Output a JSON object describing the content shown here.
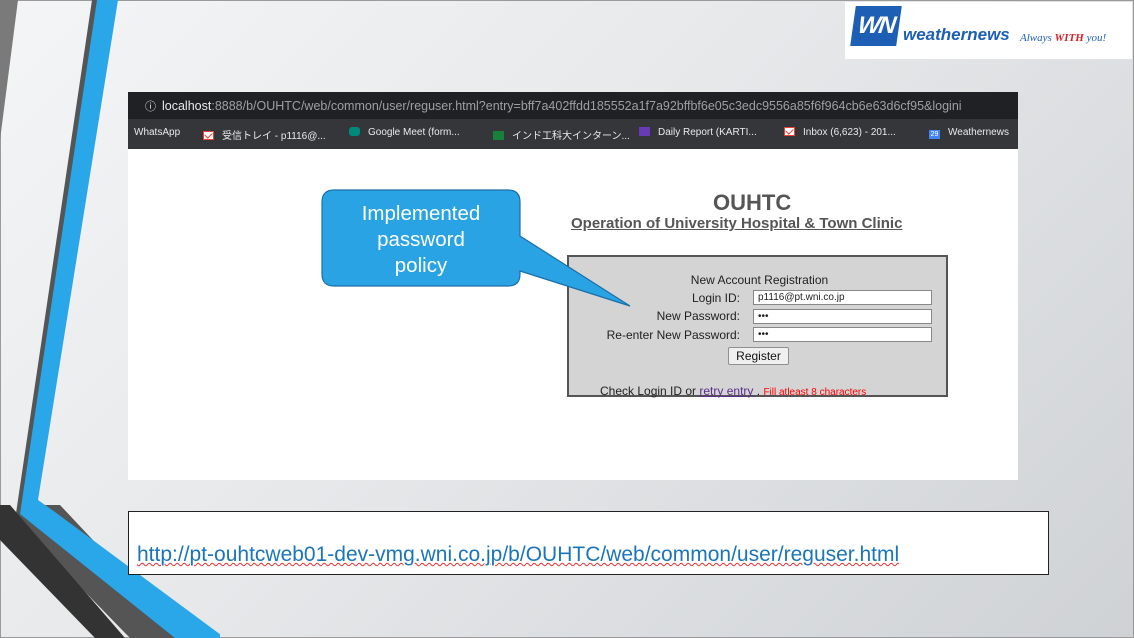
{
  "browser": {
    "address_bar": {
      "host": "localhost",
      "path": ":8888/b/OUHTC/web/common/user/reguser.html?entry=bff7a402ffdd185552a1f7a92bffbf6e05c3edc9556a85f6f964cb6e63d6cf95&logini"
    },
    "bookmarks": [
      {
        "label": "WhatsApp",
        "icon": "whatsapp-icon"
      },
      {
        "label": "受信トレイ - p1116@...",
        "icon": "gmail-icon"
      },
      {
        "label": "Google Meet (form...",
        "icon": "google-meet-icon"
      },
      {
        "label": "インド工科大インターン...",
        "icon": "google-sheets-icon"
      },
      {
        "label": "Daily Report (KARTI...",
        "icon": "google-forms-icon"
      },
      {
        "label": "Inbox (6,623) - 201...",
        "icon": "gmail-icon"
      },
      {
        "label": "Weathernews",
        "icon": "calendar-icon",
        "icon_text": "29"
      }
    ]
  },
  "app": {
    "title": "OUHTC",
    "subtitle": "Operation of University Hospital & Town Clinic"
  },
  "registration": {
    "heading": "New Account Registration",
    "login_id_label": "Login ID:",
    "login_id_value": "p1116@pt.wni.co.jp",
    "new_password_label": "New Password:",
    "new_password_value": "•••",
    "reenter_password_label": "Re-enter New Password:",
    "reenter_password_value": "•••",
    "register_button": "Register",
    "footer_prefix": "Check Login ID or",
    "retry_link": "retry entry",
    "footer_dot": ".",
    "error_message": "Fill atleast 8 characters"
  },
  "callout": {
    "lines": [
      "Implemented",
      "password",
      "policy"
    ],
    "color": "#29a3e3"
  },
  "logo": {
    "mark": "WN",
    "name": "weathernews",
    "tagline_pre": "Always ",
    "tagline_em": "WITH",
    "tagline_post": " you!",
    "brand_color": "#1d5fb5"
  },
  "url_box": {
    "url": "http://pt-ouhtcweb01-dev-vmg.wni.co.jp/b/OUHTC/web/common/user/reguser.html"
  }
}
